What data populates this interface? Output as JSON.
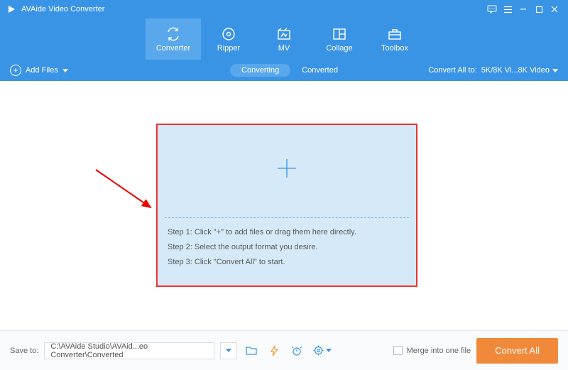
{
  "app": {
    "title": "AVAide Video Converter"
  },
  "nav": {
    "items": [
      {
        "label": "Converter"
      },
      {
        "label": "Ripper"
      },
      {
        "label": "MV"
      },
      {
        "label": "Collage"
      },
      {
        "label": "Toolbox"
      }
    ]
  },
  "subbar": {
    "add_files": "Add Files",
    "converting": "Converting",
    "converted": "Converted",
    "convert_all_to": "Convert All to:",
    "format_selected": "5K/8K Vi...8K Video"
  },
  "dropzone": {
    "step1": "Step 1: Click \"+\" to add files or drag them here directly.",
    "step2": "Step 2: Select the output format you desire.",
    "step3": "Step 3: Click \"Convert All\" to start."
  },
  "footer": {
    "save_to_label": "Save to:",
    "path": "C:\\AVAide Studio\\AVAid...eo Converter\\Converted",
    "merge_label": "Merge into one file",
    "convert_all": "Convert All"
  }
}
